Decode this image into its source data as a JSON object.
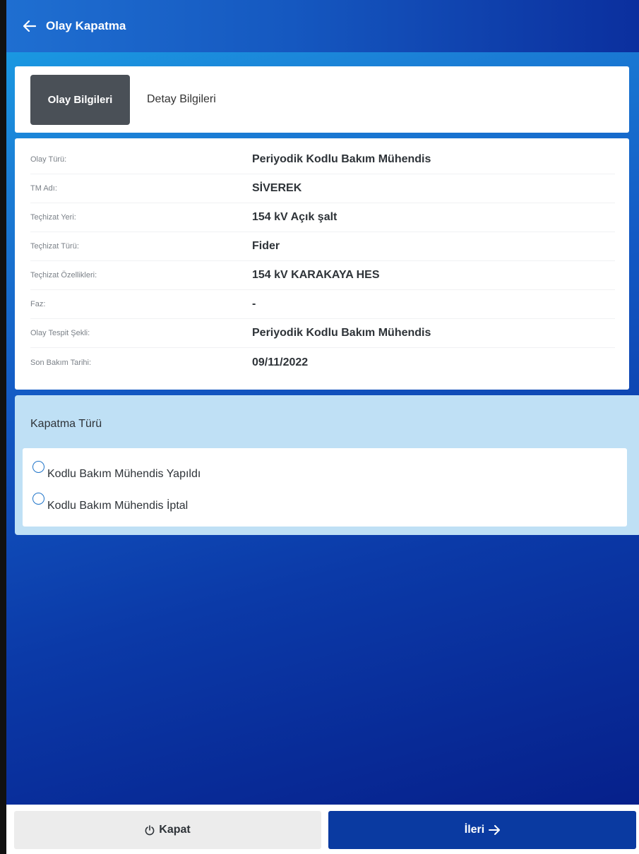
{
  "header": {
    "title": "Olay Kapatma",
    "back_icon": "arrow-left-icon"
  },
  "tabs": [
    {
      "label": "Olay Bilgileri",
      "active": true
    },
    {
      "label": "Detay Bilgileri",
      "active": false
    }
  ],
  "info": [
    {
      "label": "Olay Türü:",
      "value": "Periyodik Kodlu Bakım Mühendis"
    },
    {
      "label": "TM Adı:",
      "value": "SİVEREK"
    },
    {
      "label": "Teçhizat Yeri:",
      "value": "154 kV Açık şalt"
    },
    {
      "label": "Teçhizat Türü:",
      "value": "Fider"
    },
    {
      "label": "Teçhizat Özellikleri:",
      "value": "154 kV KARAKAYA HES"
    },
    {
      "label": "Faz:",
      "value": "-"
    },
    {
      "label": "Olay Tespit Şekli:",
      "value": "Periyodik Kodlu Bakım Mühendis"
    },
    {
      "label": "Son Bakım Tarihi:",
      "value": "09/11/2022"
    }
  ],
  "closure": {
    "title": "Kapatma Türü",
    "options": [
      {
        "label": "Kodlu Bakım Mühendis Yapıldı",
        "selected": false
      },
      {
        "label": "Kodlu Bakım Mühendis İptal",
        "selected": false
      }
    ]
  },
  "footer": {
    "close_label": "Kapat",
    "close_icon": "power-icon",
    "next_label": "İleri",
    "next_icon": "arrow-right-icon"
  },
  "colors": {
    "header": "#1558c0",
    "primary_button": "#0a3aa1",
    "active_tab": "#4a5057",
    "closure_section": "#bfe0f5"
  }
}
